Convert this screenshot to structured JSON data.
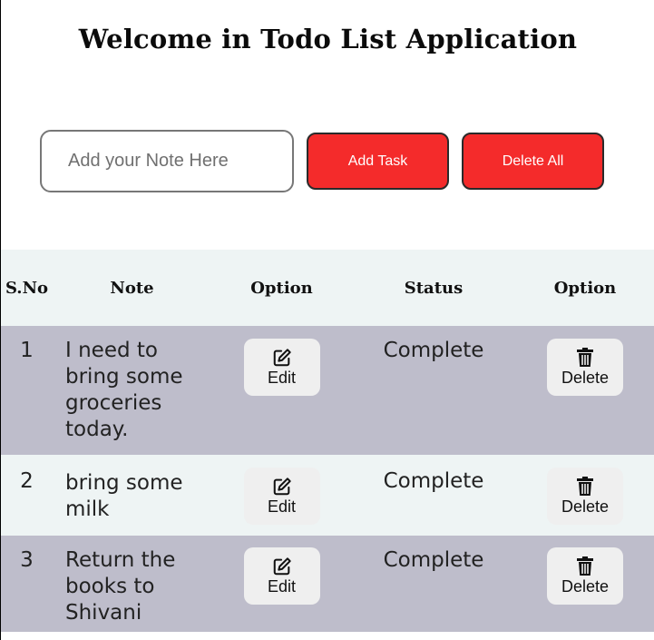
{
  "header": {
    "title": "Welcome in Todo List Application"
  },
  "input": {
    "placeholder": "Add your Note Here",
    "value": ""
  },
  "buttons": {
    "add_task": "Add Task",
    "delete_all": "Delete All"
  },
  "table": {
    "headers": [
      "S.No",
      "Note",
      "Option",
      "Status",
      "Option"
    ],
    "rows": [
      {
        "sno": "1",
        "note": "I need to bring some groceries today.",
        "edit": "Edit",
        "status": "Complete",
        "delete": "Delete"
      },
      {
        "sno": "2",
        "note": "bring some milk",
        "edit": "Edit",
        "status": "Complete",
        "delete": "Delete"
      },
      {
        "sno": "3",
        "note": "Return the books to Shivani",
        "edit": "Edit",
        "status": "Complete",
        "delete": "Delete"
      }
    ]
  },
  "icons": {
    "edit": "edit-icon",
    "delete": "trash-icon"
  },
  "colors": {
    "accent": "#f42b2b",
    "row_odd": "#bebdcb",
    "row_even": "#eef4f4",
    "header_bg": "#eef4f4"
  }
}
